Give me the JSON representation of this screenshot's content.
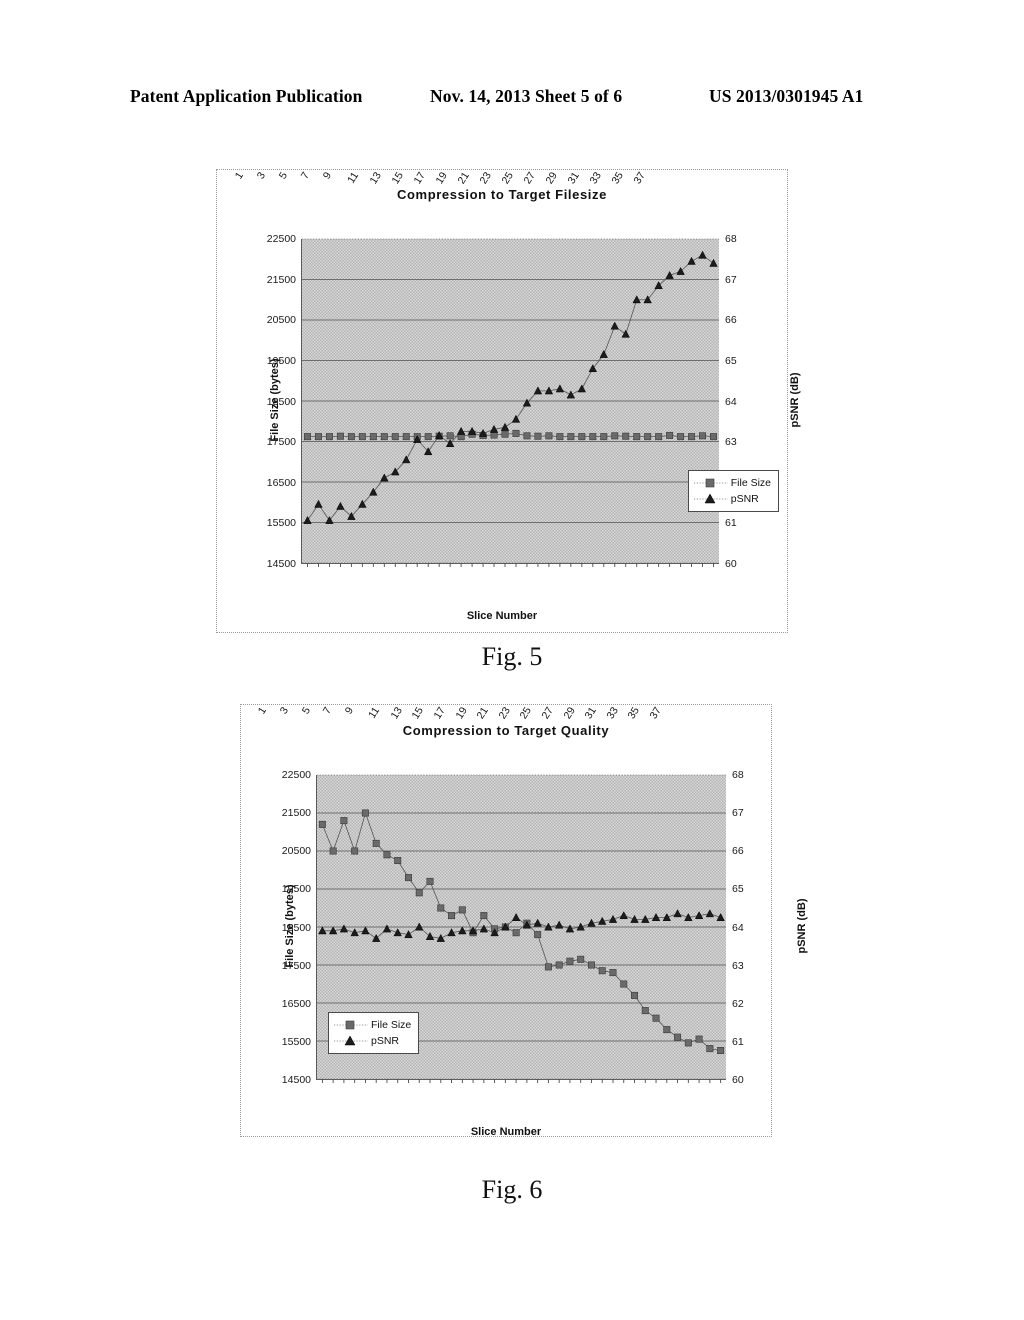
{
  "header": {
    "publication": "Patent Application Publication",
    "date_sheet": "Nov. 14, 2013  Sheet 5 of 6",
    "patent_number": "US 2013/0301945 A1"
  },
  "figures": [
    {
      "id": "figure-5",
      "caption": "Fig. 5"
    },
    {
      "id": "figure-6",
      "caption": "Fig. 6"
    }
  ],
  "axis": {
    "y_left_title": "File Size (bytes)",
    "y_right_title": "pSNR (dB)",
    "x_title": "Slice Number",
    "y_left_ticks": [
      "22500",
      "21500",
      "20500",
      "19500",
      "18500",
      "17500",
      "16500",
      "15500",
      "14500"
    ],
    "y_right_ticks": [
      "68",
      "67",
      "66",
      "65",
      "64",
      "63",
      "62",
      "61",
      "60"
    ],
    "x_ticks": [
      "1",
      "3",
      "5",
      "7",
      "9",
      "11",
      "13",
      "15",
      "17",
      "19",
      "21",
      "23",
      "25",
      "27",
      "29",
      "31",
      "33",
      "35",
      "37"
    ]
  },
  "legend": {
    "file_size": "File Size",
    "psnr": "pSNR"
  },
  "colors": {
    "plot_fill": "#c6c6c6",
    "gridline": "#6e6e6e",
    "file_size_marker": "#6a6a6a",
    "psnr_marker": "#1c1c1c"
  },
  "chart_data": [
    {
      "type": "line",
      "title": "Compression to Target Filesize",
      "xlabel": "Slice Number",
      "ylabel": "File Size (bytes)",
      "y2label": "pSNR (dB)",
      "ylim": [
        14500,
        22500
      ],
      "y2lim": [
        60,
        68
      ],
      "grid": true,
      "legend_position": "bottom-right",
      "x": [
        1,
        2,
        3,
        4,
        5,
        6,
        7,
        8,
        9,
        10,
        11,
        12,
        13,
        14,
        15,
        16,
        17,
        18,
        19,
        20,
        21,
        22,
        23,
        24,
        25,
        26,
        27,
        28,
        29,
        30,
        31,
        32,
        33,
        34,
        35,
        36,
        37,
        38
      ],
      "series": [
        {
          "name": "File Size",
          "axis": "left",
          "marker": "square",
          "values": [
            17620,
            17620,
            17620,
            17630,
            17620,
            17620,
            17620,
            17620,
            17620,
            17620,
            17620,
            17620,
            17630,
            17640,
            17620,
            17680,
            17650,
            17660,
            17680,
            17700,
            17640,
            17630,
            17640,
            17620,
            17620,
            17620,
            17620,
            17620,
            17640,
            17630,
            17620,
            17620,
            17620,
            17650,
            17620,
            17620,
            17640,
            17620
          ]
        },
        {
          "name": "pSNR",
          "axis": "right",
          "marker": "triangle",
          "values": [
            61.05,
            61.45,
            61.05,
            61.4,
            61.15,
            61.45,
            61.75,
            62.1,
            62.25,
            62.55,
            63.05,
            62.75,
            63.15,
            62.95,
            63.25,
            63.25,
            63.2,
            63.3,
            63.35,
            63.55,
            63.95,
            64.25,
            64.25,
            64.3,
            64.15,
            64.3,
            64.8,
            65.15,
            65.85,
            65.65,
            66.5,
            66.5,
            66.85,
            67.1,
            67.2,
            67.45,
            67.6,
            67.4
          ]
        }
      ]
    },
    {
      "type": "line",
      "title": "Compression to Target Quality",
      "xlabel": "Slice Number",
      "ylabel": "File Size (bytes)",
      "y2label": "pSNR (dB)",
      "ylim": [
        14500,
        22500
      ],
      "y2lim": [
        60,
        68
      ],
      "grid": true,
      "legend_position": "bottom-left",
      "x": [
        1,
        2,
        3,
        4,
        5,
        6,
        7,
        8,
        9,
        10,
        11,
        12,
        13,
        14,
        15,
        16,
        17,
        18,
        19,
        20,
        21,
        22,
        23,
        24,
        25,
        26,
        27,
        28,
        29,
        30,
        31,
        32,
        33,
        34,
        35,
        36,
        37,
        38
      ],
      "series": [
        {
          "name": "File Size",
          "axis": "left",
          "marker": "square",
          "values": [
            21200,
            20500,
            21300,
            20500,
            21500,
            20700,
            20400,
            20250,
            19800,
            19400,
            19700,
            19000,
            18800,
            18950,
            18350,
            18800,
            18450,
            18500,
            18350,
            18600,
            18300,
            17450,
            17500,
            17600,
            17650,
            17500,
            17350,
            17300,
            17000,
            16700,
            16300,
            16100,
            15800,
            15600,
            15450,
            15550,
            15300,
            15250
          ]
        },
        {
          "name": "pSNR",
          "axis": "right",
          "marker": "triangle",
          "values": [
            63.9,
            63.9,
            63.95,
            63.85,
            63.9,
            63.7,
            63.95,
            63.85,
            63.8,
            64.0,
            63.75,
            63.7,
            63.85,
            63.9,
            63.9,
            63.95,
            63.85,
            64.0,
            64.25,
            64.05,
            64.1,
            64.0,
            64.05,
            63.95,
            64.0,
            64.1,
            64.15,
            64.2,
            64.3,
            64.2,
            64.2,
            64.25,
            64.25,
            64.35,
            64.25,
            64.3,
            64.35,
            64.25
          ]
        }
      ]
    }
  ]
}
